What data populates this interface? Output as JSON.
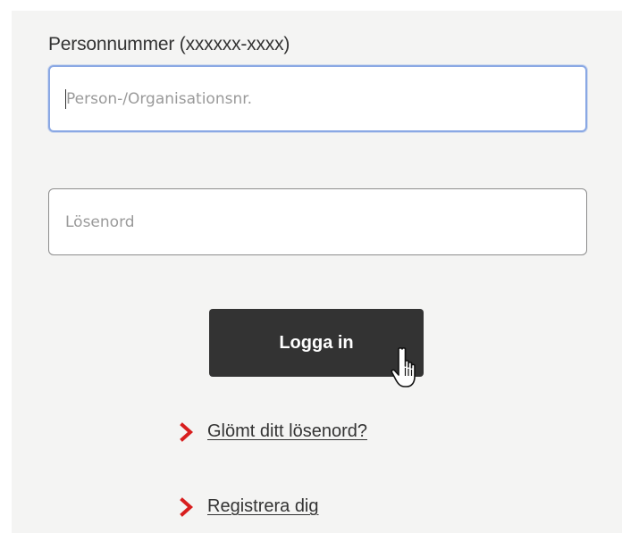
{
  "form": {
    "personnr_label": "Personnummer (xxxxxx-xxxx)",
    "personnr_placeholder": "Person-/Organisationsnr.",
    "personnr_value": "",
    "password_placeholder": "Lösenord",
    "password_value": "",
    "login_label": "Logga in"
  },
  "links": {
    "forgot_label": "Glömt ditt lösenord?",
    "register_label": "Registrera dig"
  },
  "icons": {
    "link_chevron": "chevron-right-icon",
    "cursor": "hand-pointer-cursor-icon"
  },
  "colors": {
    "panel_background": "#f4f4f3",
    "button_background": "#333333",
    "button_text": "#ffffff",
    "chevron": "#d81e1e",
    "focus_border": "#8aa8e4",
    "text": "#333333"
  }
}
